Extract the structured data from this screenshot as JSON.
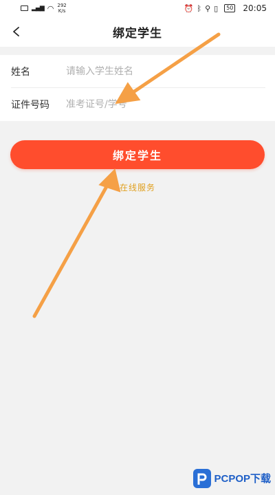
{
  "status_bar": {
    "network": "4G",
    "speed_value": "292",
    "speed_unit": "K/s",
    "battery": "50",
    "time": "20:05"
  },
  "header": {
    "title": "绑定学生",
    "back_icon": "chevron-left-icon"
  },
  "form": {
    "name_label": "姓名",
    "name_placeholder": "请输入学生姓名",
    "name_value": "",
    "id_label": "证件号码",
    "id_placeholder": "准考证号/学号",
    "id_value": ""
  },
  "actions": {
    "bind_button_label": "绑定学生",
    "online_service_label": "在线服务"
  },
  "colors": {
    "accent": "#ff4d2d",
    "link": "#e0a020",
    "annotation_arrow": "#f5a046"
  },
  "watermark": {
    "brand": "PCPOP下载"
  }
}
